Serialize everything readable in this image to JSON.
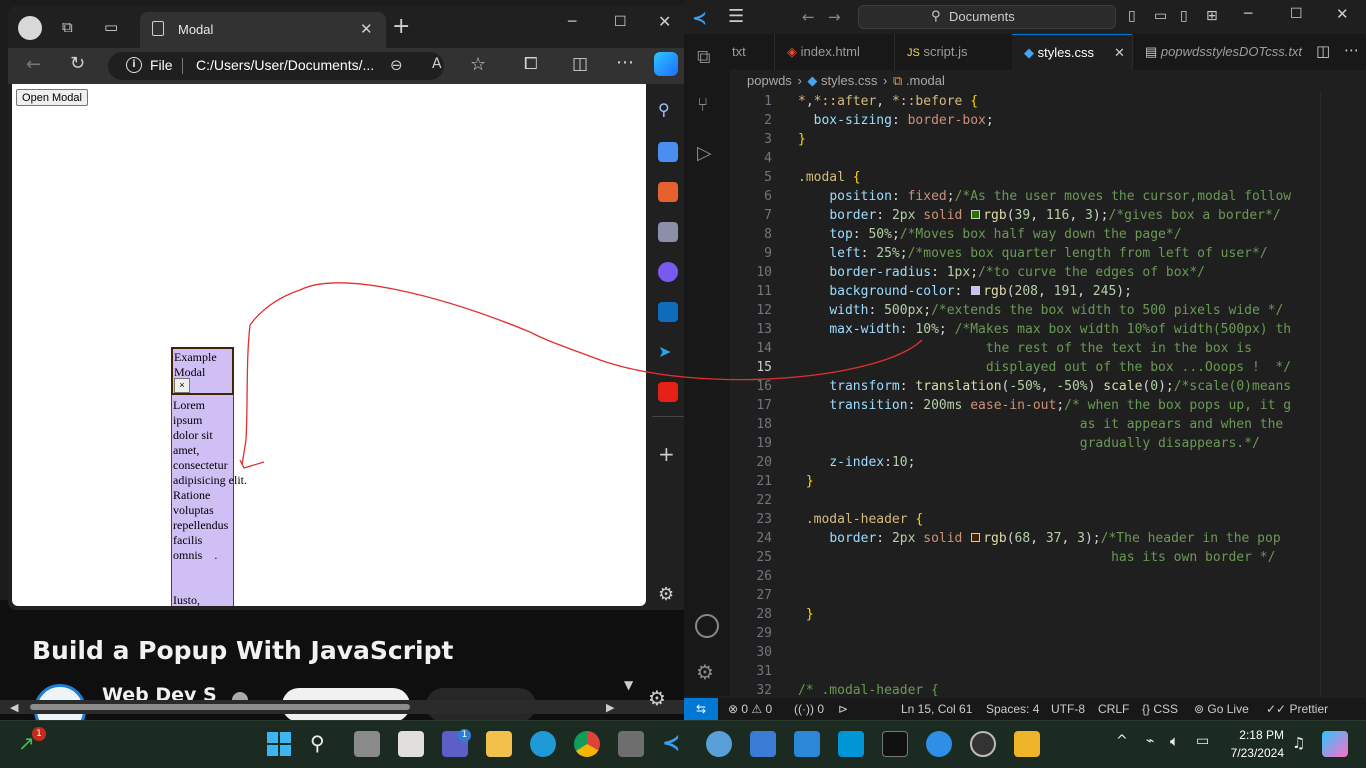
{
  "video": {
    "title": "Build a Popup With JavaScript",
    "channel": "Web Dev S"
  },
  "browser": {
    "tab_title": "Modal",
    "address_scheme": "File",
    "address_url": "C:/Users/User/Documents/...",
    "page": {
      "open_button": "Open Modal",
      "modal_title": "Example\nModal",
      "modal_close": "×",
      "modal_body": "Lorem\nipsum\ndolor sit\namet,\nconsectetur\nadipisicing elit.\nRatione\nvoluptas\nrepellendus\nfacilis\nomnis    .\n\n\nIusto,"
    }
  },
  "vscode": {
    "search": "Documents",
    "tabs": [
      "txt",
      "index.html",
      "script.js",
      "styles.css",
      "popwdsstylesDOTcss.txt"
    ],
    "active_tab": "styles.css",
    "breadcrumb": {
      "folder": "popwds",
      "file": "styles.css",
      "symbol": ".modal"
    },
    "status": {
      "errors": "0",
      "warnings": "0",
      "ports": "0",
      "position": "Ln 15, Col 61",
      "spaces": "Spaces: 4",
      "encoding": "UTF-8",
      "eol": "CRLF",
      "language": "CSS",
      "go_live": "Go Live",
      "prettier": "Prettier"
    }
  },
  "taskbar": {
    "time": "2:18 PM",
    "date": "7/23/2024",
    "badge_count": "1",
    "teams_badge": "1"
  }
}
